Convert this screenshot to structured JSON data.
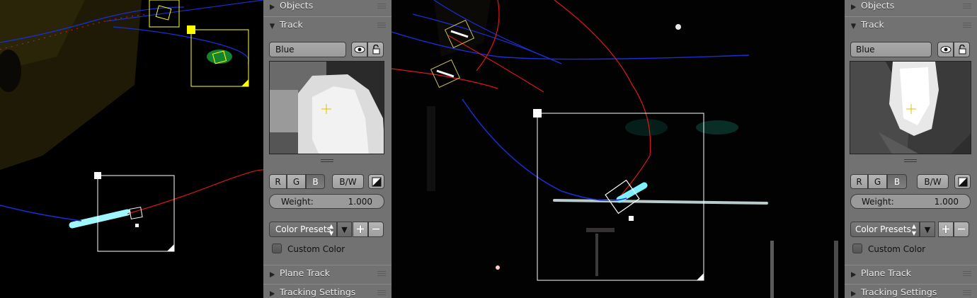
{
  "panel_left": {
    "objects_label": "Objects",
    "track_label": "Track",
    "track_name": "Blue",
    "channels": [
      "R",
      "G",
      "B"
    ],
    "bw_label": "B/W",
    "weight_label": "Weight:",
    "weight_value": "1.000",
    "color_presets_label": "Color Presets",
    "custom_color_label": "Custom Color",
    "plane_track_label": "Plane Track",
    "tracking_settings_label": "Tracking Settings"
  },
  "panel_right": {
    "objects_label": "Objects",
    "track_label": "Track",
    "track_name": "Blue",
    "channels": [
      "R",
      "G",
      "B"
    ],
    "bw_label": "B/W",
    "weight_label": "Weight:",
    "weight_value": "1.000",
    "color_presets_label": "Color Presets",
    "custom_color_label": "Custom Color",
    "plane_track_label": "Plane Track",
    "tracking_settings_label": "Tracking Settings"
  },
  "icons": {
    "visibility": "eye-icon",
    "lock": "lock-icon",
    "channel_toggle": "contrast-icon",
    "preset_menu": "dropdown-arrow-icon",
    "add": "plus-icon",
    "remove": "minus-icon"
  },
  "colors": {
    "panel_bg": "#727272",
    "track_path_blue": "#1a2ed6",
    "track_path_red": "#e01818",
    "selected_marker": "#ffffff",
    "active_marker": "#ffff00"
  }
}
